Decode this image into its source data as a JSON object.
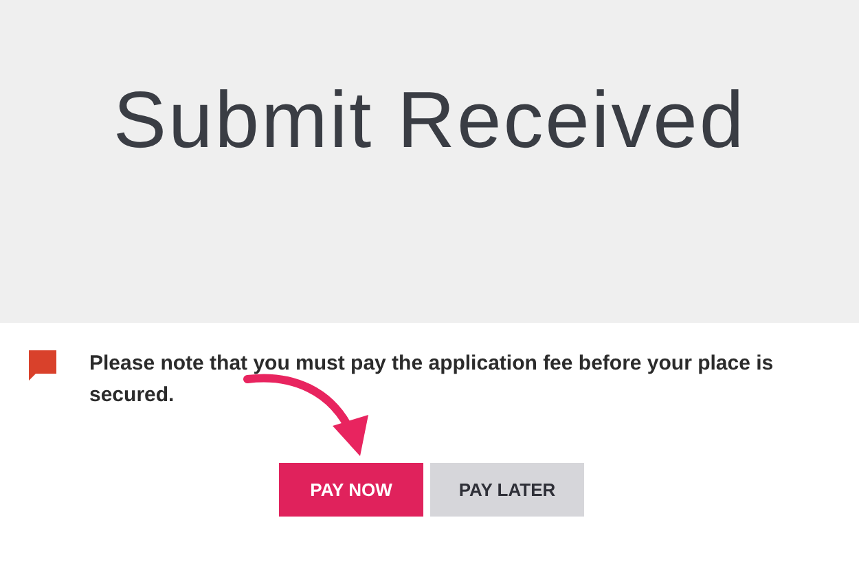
{
  "header": {
    "title": "Submit Received"
  },
  "notice": {
    "text": "Please note that you must pay the application fee before your place is secured."
  },
  "buttons": [
    {
      "label": "PAY NOW",
      "kind": "primary"
    },
    {
      "label": "PAY LATER",
      "kind": "secondary"
    }
  ]
}
